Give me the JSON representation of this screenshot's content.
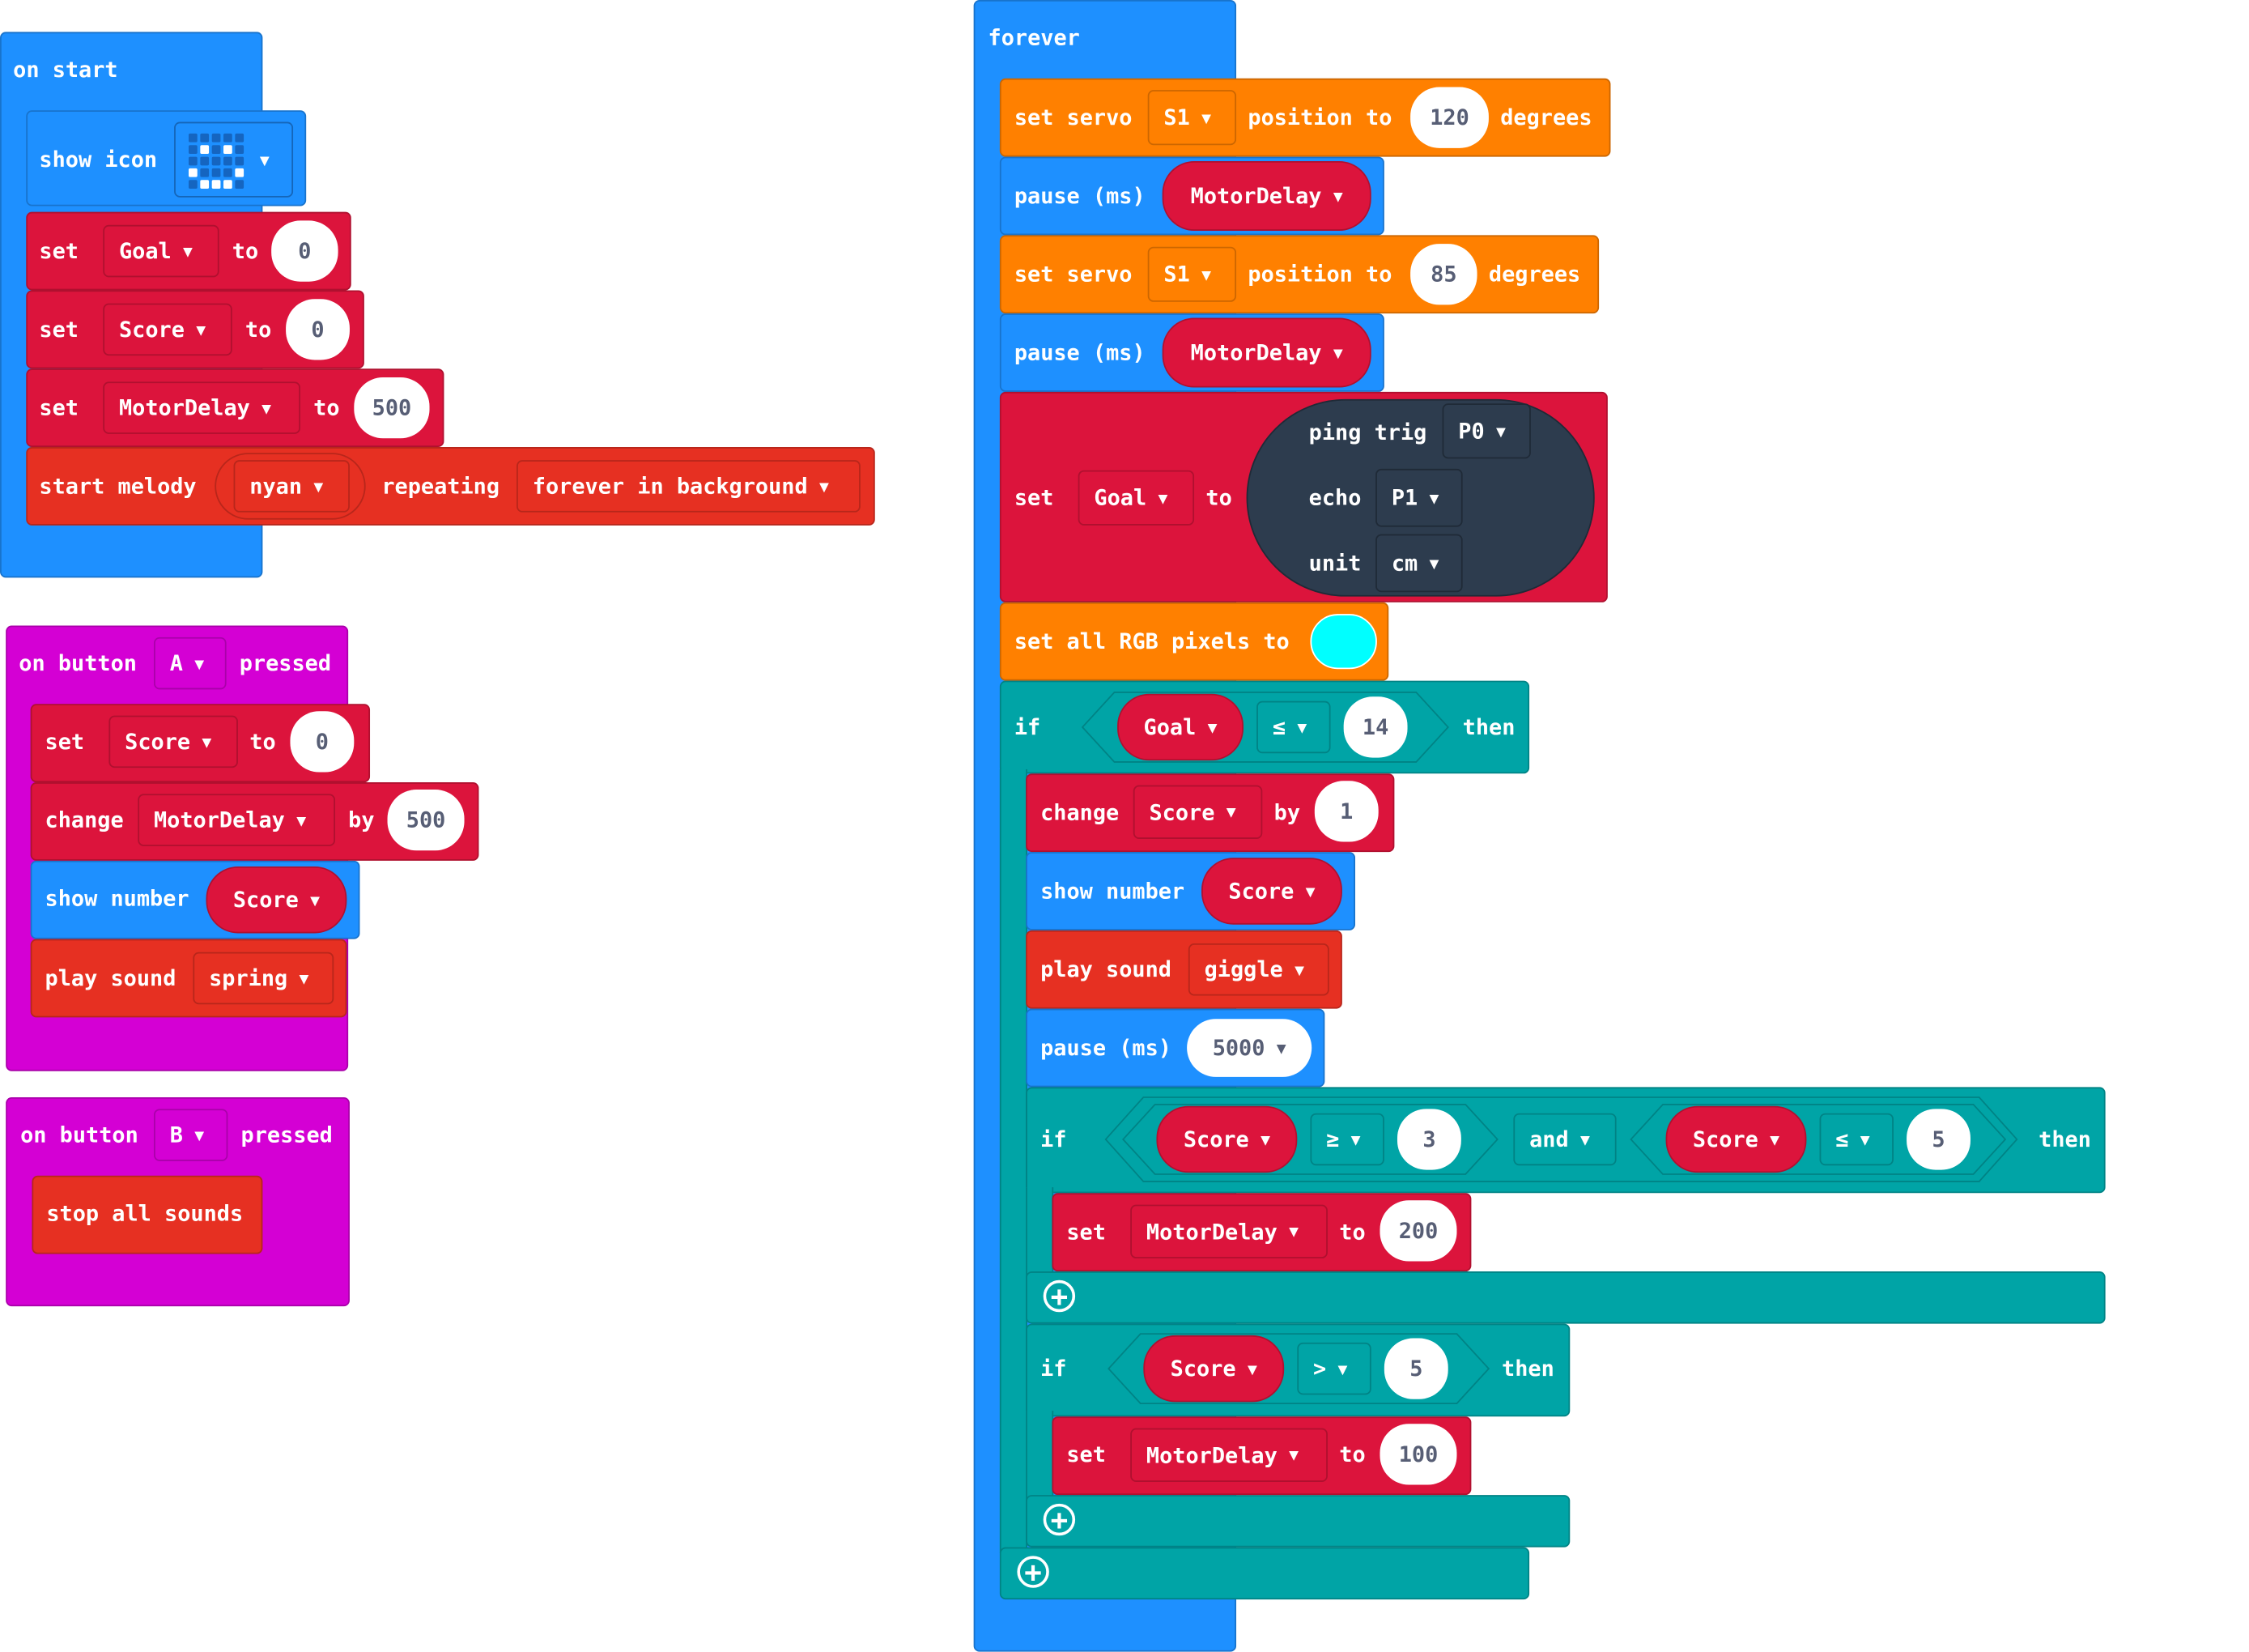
{
  "on_start": {
    "label": "on start",
    "show_icon": {
      "label": "show icon",
      "icon": "smiley-led-icon",
      "leds": [
        [
          0,
          0,
          0,
          0,
          0
        ],
        [
          0,
          1,
          0,
          1,
          0
        ],
        [
          0,
          0,
          0,
          0,
          0
        ],
        [
          1,
          0,
          0,
          0,
          1
        ],
        [
          0,
          1,
          1,
          1,
          0
        ]
      ]
    },
    "set_goal": {
      "set": "set",
      "var": "Goal",
      "to": "to",
      "value": "0"
    },
    "set_score": {
      "set": "set",
      "var": "Score",
      "to": "to",
      "value": "0"
    },
    "set_motor": {
      "set": "set",
      "var": "MotorDelay",
      "to": "to",
      "value": "500"
    },
    "melody": {
      "label": "start melody",
      "melody": "nyan",
      "repeating": "repeating",
      "mode": "forever in background"
    }
  },
  "button_a": {
    "on": "on button",
    "button": "A",
    "pressed": "pressed",
    "set_score": {
      "set": "set",
      "var": "Score",
      "to": "to",
      "value": "0"
    },
    "change": {
      "label": "change",
      "var": "MotorDelay",
      "by": "by",
      "value": "500"
    },
    "show_number": {
      "label": "show number",
      "var": "Score"
    },
    "play_sound": {
      "label": "play sound",
      "sound": "spring"
    }
  },
  "button_b": {
    "on": "on button",
    "button": "B",
    "pressed": "pressed",
    "stop": "stop all sounds"
  },
  "forever": {
    "label": "forever",
    "servo1": {
      "set": "set servo",
      "servo": "S1",
      "position": "position to",
      "value": "120",
      "degrees": "degrees"
    },
    "pause1": {
      "label": "pause (ms)",
      "var": "MotorDelay"
    },
    "servo2": {
      "set": "set servo",
      "servo": "S1",
      "position": "position to",
      "value": "85",
      "degrees": "degrees"
    },
    "pause2": {
      "label": "pause (ms)",
      "var": "MotorDelay"
    },
    "set_goal": {
      "set": "set",
      "var": "Goal",
      "to": "to",
      "ping": "ping trig",
      "trig": "P0",
      "echo": "echo",
      "echo_pin": "P1",
      "unit": "unit",
      "unit_val": "cm"
    },
    "rgb": {
      "label": "set all RGB pixels to",
      "color": "#00FFFF"
    },
    "if1": {
      "if": "if",
      "var": "Goal",
      "op": "≤",
      "value": "14",
      "then": "then",
      "change": {
        "label": "change",
        "var": "Score",
        "by": "by",
        "value": "1"
      },
      "show_number": {
        "label": "show number",
        "var": "Score"
      },
      "play_sound": {
        "label": "play sound",
        "sound": "giggle"
      },
      "pause": {
        "label": "pause (ms)",
        "value": "5000"
      },
      "if2": {
        "if": "if",
        "var1": "Score",
        "op1": "≥",
        "val1": "3",
        "and": "and",
        "var2": "Score",
        "op2": "≤",
        "val2": "5",
        "then": "then",
        "set": {
          "set": "set",
          "var": "MotorDelay",
          "to": "to",
          "value": "200"
        }
      },
      "if3": {
        "if": "if",
        "var": "Score",
        "op": ">",
        "value": "5",
        "then": "then",
        "set": {
          "set": "set",
          "var": "MotorDelay",
          "to": "to",
          "value": "100"
        }
      }
    }
  },
  "colors": {
    "basic": "#1E90FF",
    "variables": "#DC143C",
    "music": "#E63022",
    "servo": "#FF8000",
    "input": "#D400D4",
    "logic": "#00A4A6",
    "sonar": "#2D3C4E"
  }
}
